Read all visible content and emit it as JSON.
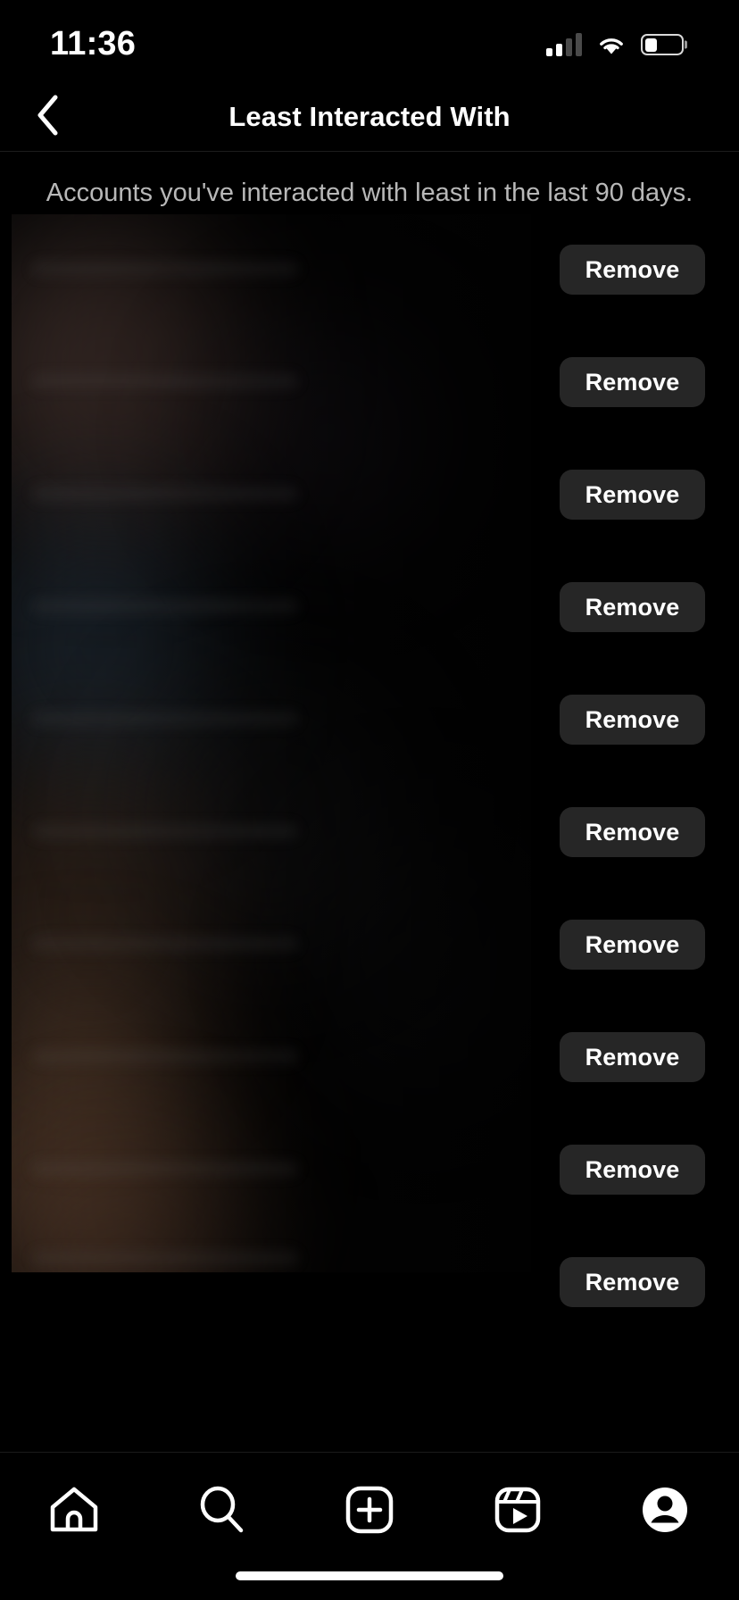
{
  "status_bar": {
    "time": "11:36",
    "cellular_icon": "cellular-signal-icon",
    "cellular_bars_filled": 2,
    "cellular_bars_total": 4,
    "wifi_icon": "wifi-icon",
    "battery_icon": "battery-icon",
    "battery_level_percent": 35
  },
  "header": {
    "back_icon": "chevron-left-icon",
    "title": "Least Interacted With"
  },
  "subtitle": "Accounts you've interacted with least in the last 90 days.",
  "list": {
    "remove_label": "Remove",
    "rows": [
      {
        "remove_label": "Remove"
      },
      {
        "remove_label": "Remove"
      },
      {
        "remove_label": "Remove"
      },
      {
        "remove_label": "Remove"
      },
      {
        "remove_label": "Remove"
      },
      {
        "remove_label": "Remove"
      },
      {
        "remove_label": "Remove"
      },
      {
        "remove_label": "Remove"
      },
      {
        "remove_label": "Remove"
      },
      {
        "remove_label": "Remove"
      }
    ]
  },
  "tab_bar": {
    "items": [
      {
        "name": "home-icon",
        "label": "Home"
      },
      {
        "name": "search-icon",
        "label": "Search"
      },
      {
        "name": "create-icon",
        "label": "Create"
      },
      {
        "name": "reels-icon",
        "label": "Reels"
      },
      {
        "name": "profile-icon",
        "label": "Profile"
      }
    ]
  },
  "colors": {
    "background": "#000000",
    "button_background": "#262626",
    "text_primary": "#ffffff",
    "text_secondary": "#b8b8b8",
    "divider": "#1c1c1c"
  }
}
